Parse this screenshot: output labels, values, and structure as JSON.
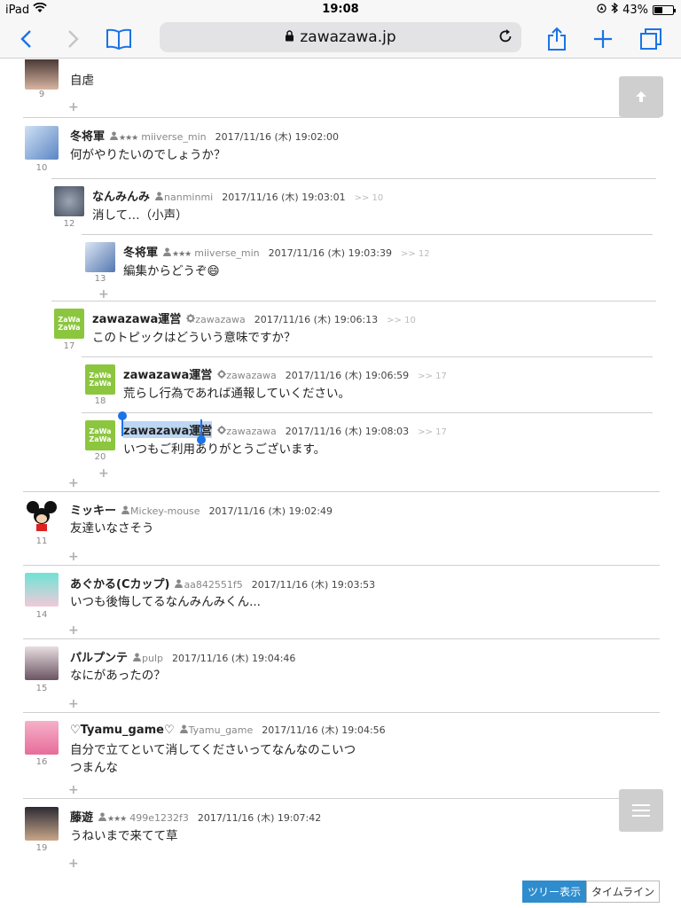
{
  "statusbar": {
    "device": "iPad",
    "time": "19:08",
    "battery": "43%",
    "battery_level": 0.43
  },
  "browser": {
    "url": "zawazawa.jp"
  },
  "comments": [
    {
      "num": "9",
      "body": "自虐"
    },
    {
      "num": "10",
      "user": "冬将軍",
      "stars": "★★★",
      "uid": "miiverse_min",
      "date": "2017/11/16 (木) 19:02:00",
      "body": "何がやりたいのでしょうか？"
    },
    {
      "num": "12",
      "user": "なんみんみ",
      "uid": "nanminmi",
      "date": "2017/11/16 (木) 19:03:01",
      "reply": ">> 10",
      "body": "消して…（小声）"
    },
    {
      "num": "13",
      "user": "冬将軍",
      "stars": "★★★",
      "uid": "miiverse_min",
      "date": "2017/11/16 (木) 19:03:39",
      "reply": ">> 12",
      "body": "編集からどうぞ😄"
    },
    {
      "num": "17",
      "user": "zawazawa運営",
      "uid": "zawazawa",
      "date": "2017/11/16 (木) 19:06:13",
      "reply": ">> 10",
      "body": "このトピックはどういう意味ですか？"
    },
    {
      "num": "18",
      "user": "zawazawa運営",
      "uid": "zawazawa",
      "date": "2017/11/16 (木) 19:06:59",
      "reply": ">> 17",
      "body": "荒らし行為であれば通報していください。"
    },
    {
      "num": "20",
      "user": "zawazawa運営",
      "uid": "zawazawa",
      "date": "2017/11/16 (木) 19:08:03",
      "reply": ">> 17",
      "body": "いつもご利用ありがとうございます。"
    },
    {
      "num": "11",
      "user": "ミッキー",
      "uid": "Mickey-mouse",
      "date": "2017/11/16 (木) 19:02:49",
      "body": "友達いなさそう"
    },
    {
      "num": "14",
      "user": "あぐかる(Cカップ)",
      "uid": "aa842551f5",
      "date": "2017/11/16 (木) 19:03:53",
      "body": "いつも後悔してるなんみんみくん..."
    },
    {
      "num": "15",
      "user": "パルプンテ",
      "uid": "pulp",
      "date": "2017/11/16 (木) 19:04:46",
      "body": "なにがあったの？"
    },
    {
      "num": "16",
      "user": "♡Tyamu_game♡",
      "uid": "Tyamu_game",
      "date": "2017/11/16 (木) 19:04:56",
      "body1": "自分で立てといて消してくださいってなんなのこいつ",
      "body2": "つまんな"
    },
    {
      "num": "19",
      "user": "藤遊",
      "stars": "★★★",
      "uid": "499e1232f3",
      "date": "2017/11/16 (木) 19:07:42",
      "body": "うねいまで来てて草"
    }
  ],
  "zawa_logo": {
    "line1": "ZaWa",
    "line2": "ZaWa"
  },
  "view_switcher": {
    "tree": "ツリー表示",
    "timeline": "タイムライン"
  },
  "colors": {
    "accent": "#1a73e8",
    "zawa_green": "#8cc63f",
    "selection": "#bcd6f4"
  }
}
